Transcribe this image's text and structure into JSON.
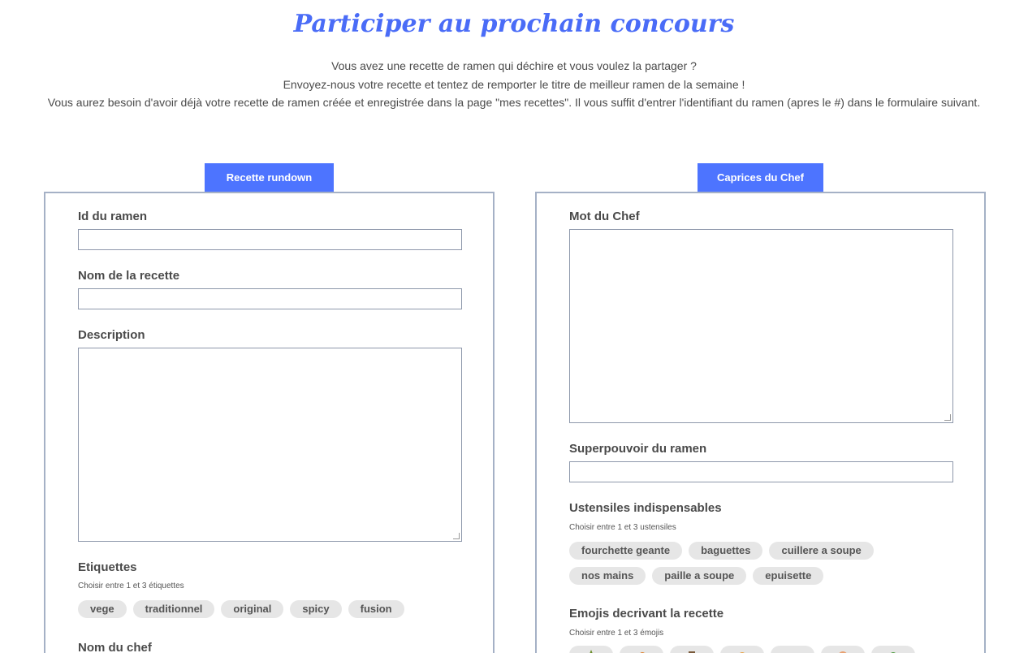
{
  "header": {
    "title": "Participer au prochain concours",
    "intro_line1": "Vous avez une recette de ramen qui déchire et vous voulez la partager ?",
    "intro_line2": "Envoyez-nous votre recette et tentez de remporter le titre de meilleur ramen de la semaine !",
    "intro_line3": "Vous aurez besoin d'avoir déjà votre recette de ramen créée et enregistrée dans la page \"mes recettes\". Il vous suffit d'entrer l'identifiant du ramen (apres le #) dans le formulaire suivant."
  },
  "left": {
    "tab": "Recette rundown",
    "id_label": "Id du ramen",
    "id_value": "",
    "name_label": "Nom de la recette",
    "name_value": "",
    "desc_label": "Description",
    "desc_value": "",
    "tags_label": "Etiquettes",
    "tags_hint": "Choisir entre 1 et 3 étiquettes",
    "tags": [
      "vege",
      "traditionnel",
      "original",
      "spicy",
      "fusion"
    ],
    "chef_label": "Nom du chef"
  },
  "right": {
    "tab": "Caprices du Chef",
    "word_label": "Mot du Chef",
    "word_value": "",
    "power_label": "Superpouvoir du ramen",
    "power_value": "",
    "tools_label": "Ustensiles indispensables",
    "tools_hint": "Choisir entre 1 et 3 ustensiles",
    "tools_row1": [
      "fourchette geante",
      "baguettes",
      "cuillere a soupe"
    ],
    "tools_row2": [
      "nos mains",
      "paille a soupe",
      "epuisette"
    ],
    "emoji_label": "Emojis decrivant la recette",
    "emoji_hint": "Choisir entre 1 et 3 émojis",
    "emoji_icons": [
      "chili-emoji-icon",
      "shrimp-emoji-icon",
      "flag-emoji-icon",
      "egg-emoji-icon",
      "fish-emoji-icon",
      "face-emoji-icon",
      "leaf-emoji-icon"
    ]
  }
}
